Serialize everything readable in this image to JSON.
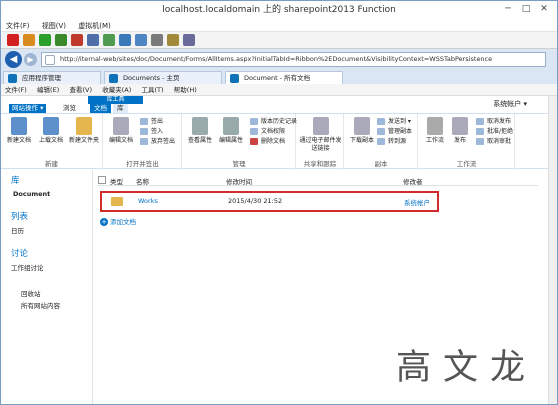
{
  "window": {
    "title": "localhost.localdomain 上的 sharepoint2013 Function",
    "min": "─",
    "max": "□",
    "close": "✕"
  },
  "vm_menu": [
    "文件(F)",
    "视图(V)",
    "虚拟机(M)"
  ],
  "vm_toolbar": {
    "icons": [
      {
        "name": "stop-icon",
        "color": "#d32020"
      },
      {
        "name": "pause-icon",
        "color": "#d98b1e"
      },
      {
        "name": "play-icon",
        "color": "#2aa02a"
      },
      {
        "name": "reset-icon",
        "color": "#3b8a2a"
      },
      {
        "name": "ctrl-alt-del-icon",
        "color": "#c0392b"
      },
      {
        "name": "snapshot-icon",
        "color": "#4f6fa8"
      },
      {
        "name": "revert-icon",
        "color": "#4f9b4f"
      },
      {
        "name": "snapshot-manager-icon",
        "color": "#3a7ab8"
      },
      {
        "name": "enhanced-session-icon",
        "color": "#4e86c4"
      },
      {
        "name": "share-icon",
        "color": "#7a7a7a"
      },
      {
        "name": "settings-icon",
        "color": "#a28a3a"
      },
      {
        "name": "usb-icon",
        "color": "#6a6a9a"
      }
    ]
  },
  "browser": {
    "url": "http://iternal-web/sites/doc/Document/Forms/AllItems.aspx?InitialTabId=Ribbon%2EDocument&VisibilityContext=WSSTabPersistence",
    "tabs": [
      {
        "label": "应用程序管理",
        "active": false
      },
      {
        "label": "Documents - 主页",
        "active": false
      },
      {
        "label": "Document - 所有文档",
        "active": true
      }
    ],
    "menu": [
      "文件(F)",
      "编辑(E)",
      "查看(V)",
      "收藏夹(A)",
      "工具(T)",
      "帮助(H)"
    ]
  },
  "sharepoint": {
    "site_menu": "网站操作 ▾",
    "browse_tab": "浏览",
    "lib_tools": "库工具",
    "doc_tab": "文档",
    "lib_tab": "库",
    "user": "系统帐户 ▾",
    "ribbon": {
      "groups": [
        "新建",
        "打开并签出",
        "管理",
        "共享和跟踪",
        "副本",
        "工作流"
      ],
      "new_doc": "新建文档",
      "upload_doc": "上载文档",
      "new_folder": "新建文件夹",
      "edit_doc": "编辑文档",
      "checkout": "签出",
      "checkin": "签入",
      "discard_checkout": "放弃签出",
      "view_props": "查看属性",
      "edit_props": "编辑属性",
      "version_history": "版本历史记录",
      "doc_permissions": "文档权限",
      "delete_doc": "删除文档",
      "email_link": "通过电子邮件发送链接",
      "download_copy": "下载副本",
      "send_to": "发送到 ▾",
      "manage_copies": "管理副本",
      "goto_source": "转到源",
      "workflow": "工作流",
      "publish": "发布",
      "unpublish": "取消发布",
      "approve": "批准/拒绝",
      "cancel_approval": "取消审批"
    },
    "left_nav": {
      "lib": "库",
      "lib_item": "Document",
      "lists": "列表",
      "calendar": "日历",
      "discuss": "讨论",
      "team_discussion": "工作组讨论",
      "recycle": "回收站",
      "all_content": "所有网站内容"
    },
    "list": {
      "headers": {
        "type": "类型",
        "name": "名称",
        "modified": "修改时间",
        "modified_by": "修改者"
      },
      "rows": [
        {
          "name": "Works",
          "modified": "2015/4/30 21:52",
          "by": "系统帐户"
        }
      ],
      "add": "添加文档"
    }
  },
  "watermark": "高文龙"
}
